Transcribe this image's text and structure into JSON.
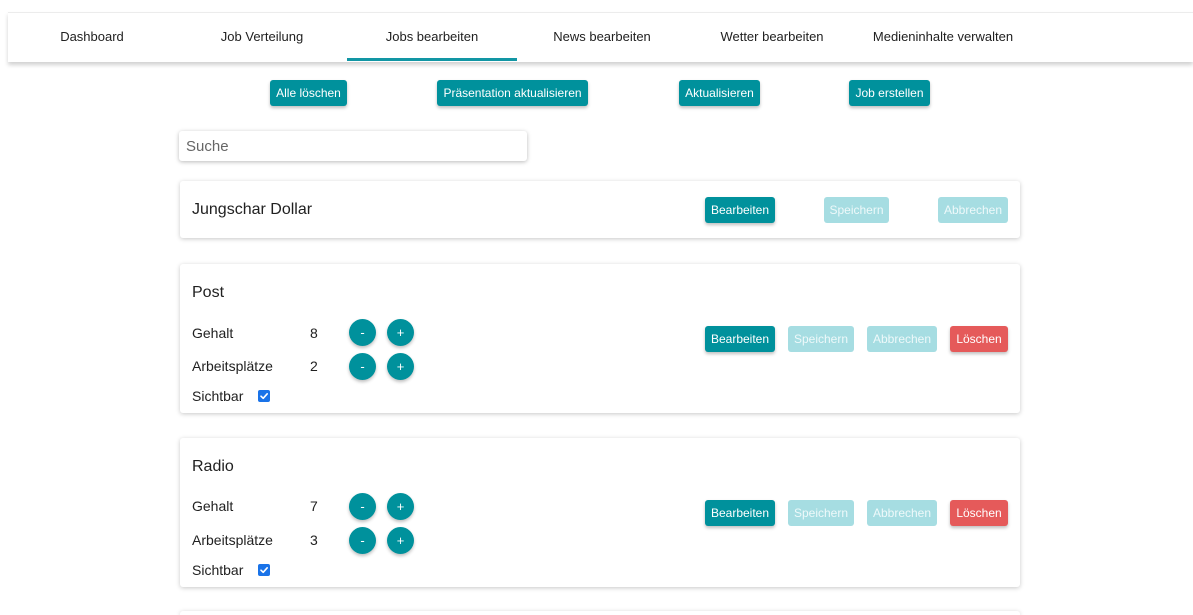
{
  "nav": {
    "tabs": [
      {
        "label": "Dashboard"
      },
      {
        "label": "Job Verteilung"
      },
      {
        "label": "Jobs bearbeiten",
        "active": true
      },
      {
        "label": "News bearbeiten"
      },
      {
        "label": "Wetter bearbeiten"
      },
      {
        "label": "Medieninhalte verwalten"
      }
    ]
  },
  "toolbar": {
    "delete_all_label": "Alle löschen",
    "update_presentation_label": "Präsentation aktualisieren",
    "refresh_label": "Aktualisieren",
    "create_job_label": "Job erstellen"
  },
  "search": {
    "placeholder": "Suche",
    "value": ""
  },
  "actions": {
    "edit_label": "Bearbeiten",
    "save_label": "Speichern",
    "cancel_label": "Abbrechen",
    "delete_label": "Löschen"
  },
  "fields": {
    "salary_label": "Gehalt",
    "positions_label": "Arbeitsplätze",
    "visible_label": "Sichtbar",
    "decrement_label": "-",
    "increment_label": "+"
  },
  "jobs": [
    {
      "name": "Jungschar Dollar"
    },
    {
      "name": "Post",
      "salary": "8",
      "positions": "2",
      "visible": true
    },
    {
      "name": "Radio",
      "salary": "7",
      "positions": "3",
      "visible": true
    }
  ],
  "colors": {
    "accent": "#00919c",
    "tab_indicator": "#1296a4",
    "disabled": "#a6dde2",
    "danger": "#e55a5a",
    "checkbox": "#1a73e8"
  }
}
